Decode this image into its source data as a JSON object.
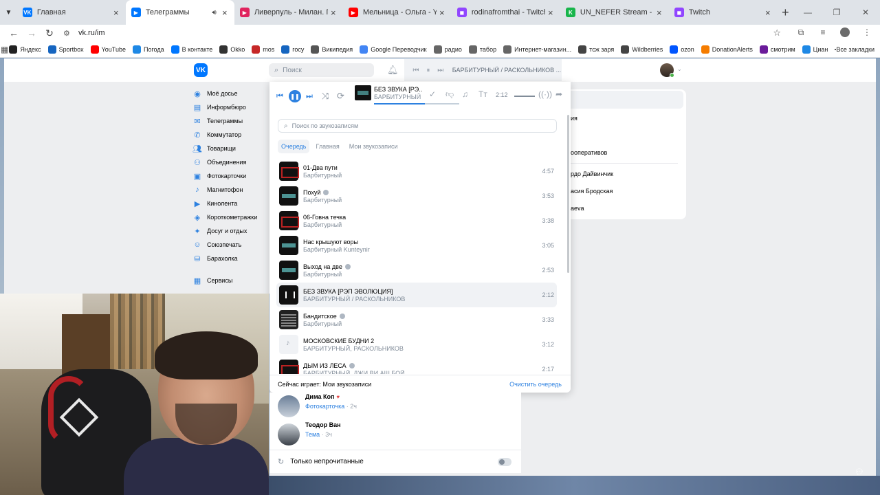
{
  "browser": {
    "tabs": [
      {
        "title": "Главная",
        "fav_color": "#0077ff",
        "fav_glyph": "vk",
        "active": false
      },
      {
        "title": "Телеграммы",
        "fav_color": "#0077ff",
        "fav_glyph": "play",
        "active": true
      },
      {
        "title": "Ливерпуль - Милан. Повтор",
        "fav_color": "#e0245e",
        "fav_glyph": "play",
        "active": false
      },
      {
        "title": "Мельница - Ольга - YouTube",
        "fav_color": "#ff0000",
        "fav_glyph": "yt",
        "active": false
      },
      {
        "title": "rodinafromthai - Twitch",
        "fav_color": "#9146ff",
        "fav_glyph": "tw",
        "active": false
      },
      {
        "title": "UN_NEFER Stream - Watch Live",
        "fav_color": "#18b54b",
        "fav_glyph": "K",
        "active": false
      },
      {
        "title": "Twitch",
        "fav_color": "#9146ff",
        "fav_glyph": "tw",
        "active": false
      }
    ],
    "url": "vk.ru/im",
    "bookmarks": [
      {
        "label": "Яндекс",
        "color": "#222"
      },
      {
        "label": "Sportbox",
        "color": "#1565c0"
      },
      {
        "label": "YouTube",
        "color": "#ff0000"
      },
      {
        "label": "Погода",
        "color": "#1e88e5"
      },
      {
        "label": "В контакте",
        "color": "#0077ff"
      },
      {
        "label": "Okko",
        "color": "#333"
      },
      {
        "label": "mos",
        "color": "#c62828"
      },
      {
        "label": "госу",
        "color": "#1565c0"
      },
      {
        "label": "Википедия",
        "color": "#555"
      },
      {
        "label": "Google Переводчик",
        "color": "#4285f4"
      },
      {
        "label": "радио",
        "color": "#666"
      },
      {
        "label": "табор",
        "color": "#666"
      },
      {
        "label": "Интернет-магазин...",
        "color": "#666"
      },
      {
        "label": "тсж заря",
        "color": "#444"
      },
      {
        "label": "Wildberries",
        "color": "#444"
      },
      {
        "label": "ozon",
        "color": "#0055ff"
      },
      {
        "label": "DonationAlerts",
        "color": "#f57c00"
      },
      {
        "label": "смотрим",
        "color": "#6a1b9a"
      },
      {
        "label": "Циан",
        "color": "#1e88e5"
      }
    ],
    "all_bookmarks": "Все закладки"
  },
  "vk": {
    "search_placeholder": "Поиск",
    "mini_player_title": "БАРБИТУРНЫЙ / РАСКОЛЬНИКОВ ...",
    "menu": [
      {
        "label": "Моё досье",
        "icon": "user-icon"
      },
      {
        "label": "Информбюро",
        "icon": "news-icon"
      },
      {
        "label": "Телеграммы",
        "icon": "message-icon"
      },
      {
        "label": "Коммутатор",
        "icon": "phone-icon"
      },
      {
        "label": "Товарищи",
        "icon": "friends-icon"
      },
      {
        "label": "Объединения",
        "icon": "groups-icon"
      },
      {
        "label": "Фотокарточки",
        "icon": "photo-icon"
      },
      {
        "label": "Магнитофон",
        "icon": "music-icon"
      },
      {
        "label": "Кинолента",
        "icon": "video-icon"
      },
      {
        "label": "Короткометражки",
        "icon": "clips-icon"
      },
      {
        "label": "Досуг и отдых",
        "icon": "games-icon"
      },
      {
        "label": "Союзпечать",
        "icon": "stickers-icon"
      },
      {
        "label": "Барахолка",
        "icon": "market-icon"
      }
    ],
    "menu_services": "Сервисы",
    "right_card": [
      "ия",
      "ооперативов",
      "рдо Дайвинчик",
      "асия Бродская",
      "aeva"
    ]
  },
  "player": {
    "now_title": "БЕЗ ЗВУКА [РЭ...",
    "now_artist": "БАРБИТУРНЫЙ ...",
    "time": "2:12",
    "progress": 0.6,
    "search_placeholder": "Поиск по звукозаписям",
    "tabs": [
      "Очередь",
      "Главная",
      "Мои звукозаписи"
    ],
    "tracks": [
      {
        "title": "01-Два пути",
        "artist": "Барбитурный",
        "duration": "4:57",
        "cover": "red",
        "explicit": false,
        "current": false
      },
      {
        "title": "Похуй",
        "artist": "Барбитурный",
        "duration": "3:53",
        "cover": "teal",
        "explicit": true,
        "current": false
      },
      {
        "title": "06-Говна течка",
        "artist": "Барбитурный",
        "duration": "3:38",
        "cover": "red",
        "explicit": false,
        "current": false
      },
      {
        "title": "Нас крышуют воры",
        "artist": "Барбитурный Kunteynir",
        "duration": "3:05",
        "cover": "teal",
        "explicit": false,
        "current": false
      },
      {
        "title": "Выход на две",
        "artist": "Барбитурный",
        "duration": "2:53",
        "cover": "teal",
        "explicit": true,
        "current": false
      },
      {
        "title": "БЕЗ ЗВУКА [РЭП ЭВОЛЮЦИЯ]",
        "artist": "БАРБИТУРНЫЙ / РАСКОЛЬНИКОВ",
        "duration": "2:12",
        "cover": "bars",
        "explicit": false,
        "current": true
      },
      {
        "title": "Бандитское",
        "artist": "Барбитурный",
        "duration": "3:33",
        "cover": "stamp",
        "explicit": true,
        "current": false
      },
      {
        "title": "МОСКОВСКИЕ БУДНИ 2",
        "artist": "БАРБИТУРНЫЙ, РАСКОЛЬНИКОВ",
        "duration": "3:12",
        "cover": "gray",
        "explicit": false,
        "current": false
      },
      {
        "title": "ДЫМ ИЗ ЛЕСА",
        "artist": "БАРБИТУРНЫЙ, ДЖИ ВИ АШ БОЙ",
        "duration": "2:17",
        "cover": "red",
        "explicit": true,
        "current": false
      }
    ],
    "now_playing_label": "Сейчас играет: Мои звукозаписи",
    "clear_queue": "Очистить очередь"
  },
  "conversations": [
    {
      "name": "Дима Коп",
      "sub": "Фотокарточка",
      "time": "2ч",
      "heart": true
    },
    {
      "name": "Теодор Ван",
      "sub": "Тема",
      "time": "3ч",
      "heart": false
    }
  ],
  "unread_only": "Только непрочитанные",
  "colors": {
    "accent": "#2d81e0",
    "vk_blue": "#0077ff"
  }
}
